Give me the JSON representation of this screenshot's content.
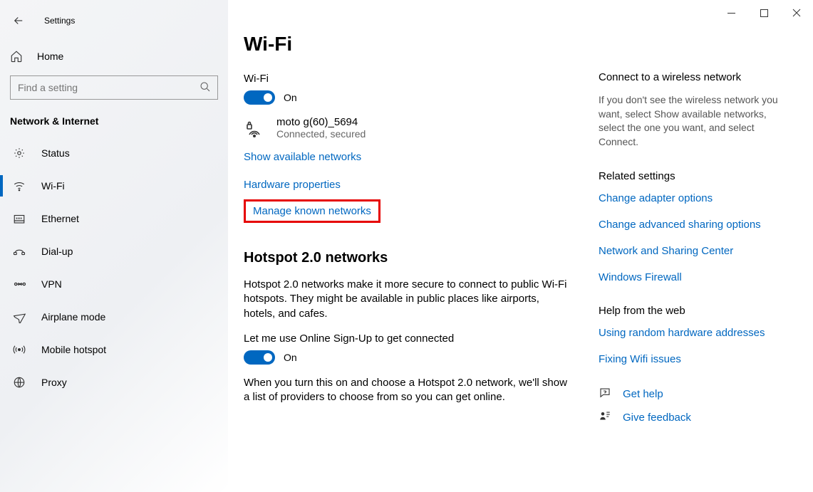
{
  "app_title": "Settings",
  "sidebar": {
    "home_label": "Home",
    "search_placeholder": "Find a setting",
    "section_title": "Network & Internet",
    "items": [
      {
        "label": "Status"
      },
      {
        "label": "Wi-Fi"
      },
      {
        "label": "Ethernet"
      },
      {
        "label": "Dial-up"
      },
      {
        "label": "VPN"
      },
      {
        "label": "Airplane mode"
      },
      {
        "label": "Mobile hotspot"
      },
      {
        "label": "Proxy"
      }
    ]
  },
  "main": {
    "page_title": "Wi-Fi",
    "wifi_label": "Wi-Fi",
    "wifi_toggle_state": "On",
    "network": {
      "name": "moto g(60)_5694",
      "status": "Connected, secured"
    },
    "links": {
      "show_networks": "Show available networks",
      "hardware_props": "Hardware properties",
      "manage_known": "Manage known networks"
    },
    "hotspot": {
      "heading": "Hotspot 2.0 networks",
      "desc": "Hotspot 2.0 networks make it more secure to connect to public Wi-Fi hotspots. They might be available in public places like airports, hotels, and cafes.",
      "signup_label": "Let me use Online Sign-Up to get connected",
      "toggle_state": "On",
      "footer": "When you turn this on and choose a Hotspot 2.0 network, we'll show a list of providers to choose from so you can get online."
    }
  },
  "aside": {
    "connect_head": "Connect to a wireless network",
    "connect_desc": "If you don't see the wireless network you want, select Show available networks, select the one you want, and select Connect.",
    "related_head": "Related settings",
    "related_links": {
      "adapter": "Change adapter options",
      "sharing": "Change advanced sharing options",
      "center": "Network and Sharing Center",
      "firewall": "Windows Firewall"
    },
    "webhelp_head": "Help from the web",
    "webhelp_links": {
      "random_hw": "Using random hardware addresses",
      "fix_wifi": "Fixing Wifi issues"
    },
    "get_help": "Get help",
    "give_feedback": "Give feedback"
  }
}
